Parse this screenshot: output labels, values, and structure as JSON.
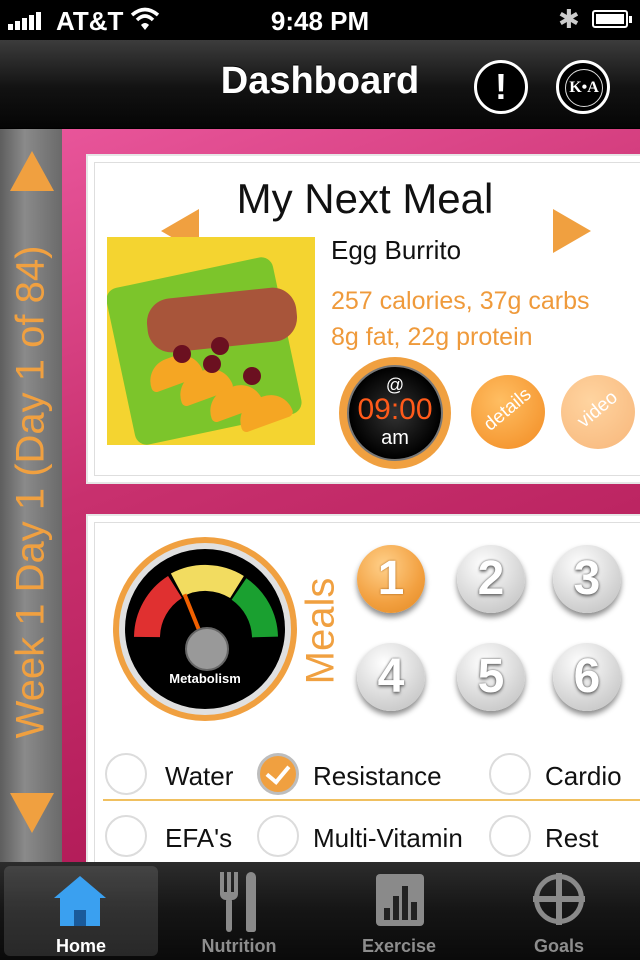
{
  "status_bar": {
    "carrier": "AT&T",
    "wifi_icon": "wifi-icon",
    "time": "9:48 PM",
    "bluetooth_glyph": "✱",
    "battery_level": 1.0
  },
  "nav": {
    "title": "Dashboard",
    "alert_symbol": "!",
    "logo_text": "K•A"
  },
  "sidebar": {
    "label": "Week 1 Day 1 (Day 1 of 84)"
  },
  "next_meal": {
    "title": "My Next Meal",
    "name": "Egg Burrito",
    "nutrition_line1": "257 calories, 37g carbs",
    "nutrition_line2": "8g fat, 22g protein",
    "time_at": "@",
    "time": "09:00",
    "ampm": "am",
    "details_label": "details",
    "video_label": "video"
  },
  "tracker": {
    "metabolism_label": "Metabolism",
    "meals_label": "Meals",
    "meal_buttons": [
      "1",
      "2",
      "3",
      "4",
      "5",
      "6"
    ],
    "active_meal": "1",
    "checklist": [
      {
        "label": "Water",
        "checked": false
      },
      {
        "label": "Resistance",
        "checked": true
      },
      {
        "label": "Cardio",
        "checked": false
      },
      {
        "label": "EFA's",
        "checked": false
      },
      {
        "label": "Multi-Vitamin",
        "checked": false
      },
      {
        "label": "Rest",
        "checked": false
      }
    ]
  },
  "tabs": [
    {
      "label": "Home",
      "icon": "home-icon",
      "active": true
    },
    {
      "label": "Nutrition",
      "icon": "fork-knife-icon",
      "active": false
    },
    {
      "label": "Exercise",
      "icon": "bar-chart-icon",
      "active": false
    },
    {
      "label": "Goals",
      "icon": "crosshair-icon",
      "active": false
    }
  ],
  "colors": {
    "accent_orange": "#f0a040",
    "magenta": "#b8185c",
    "home_blue": "#3aa0f0"
  }
}
